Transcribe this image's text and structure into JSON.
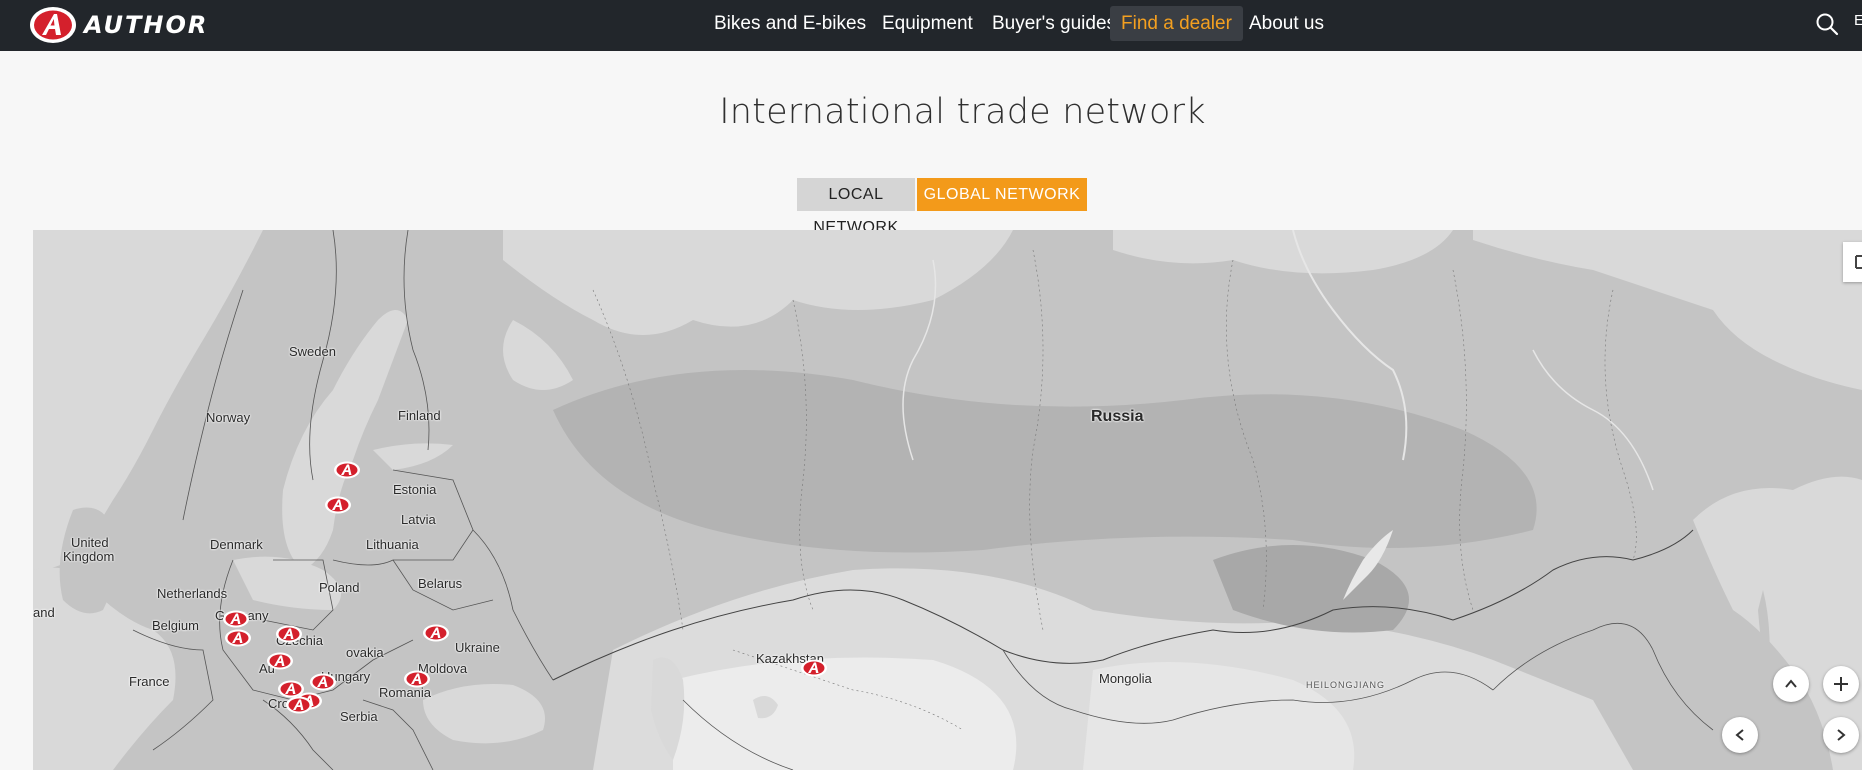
{
  "brand": {
    "name": "AUTHOR",
    "accent": "#f39a1a",
    "logo_red": "#d4202c"
  },
  "nav": {
    "items": [
      {
        "label": "Bikes and E-bikes"
      },
      {
        "label": "Equipment"
      },
      {
        "label": "Buyer's guides"
      },
      {
        "label": "Find a dealer",
        "active": true
      },
      {
        "label": "About us"
      }
    ],
    "search_icon": "search-icon",
    "language_label": "E"
  },
  "page": {
    "title": "International trade network",
    "toggle": {
      "local_label": "LOCAL NETWORK",
      "global_label": "GLOBAL NETWORK",
      "selected": "global"
    }
  },
  "map": {
    "labels": {
      "sweden": "Sweden",
      "norway": "Norway",
      "finland": "Finland",
      "estonia": "Estonia",
      "latvia": "Latvia",
      "lithuania": "Lithuania",
      "denmark": "Denmark",
      "united_kingdom_1": "United",
      "united_kingdom_2": "Kingdom",
      "ireland": "and",
      "netherlands": "Netherlands",
      "belgium": "Belgium",
      "germany": "Germany",
      "poland": "Poland",
      "belarus": "Belarus",
      "czechia": "Czechia",
      "slovakia": "ovakia",
      "austria": "Au",
      "hungary": "Hungary",
      "france": "France",
      "croatia": "Croatia",
      "serbia": "Serbia",
      "romania": "Romania",
      "moldova": "Moldova",
      "ukraine": "Ukraine",
      "russia": "Russia",
      "kazakhstan": "Kazakhstan",
      "mongolia": "Mongolia",
      "heilongjiang": "HEILONGJIANG"
    },
    "dealer_marker_count": 13,
    "controls": {
      "fullscreen_icon": "fullscreen-icon",
      "zoom_in_icon": "plus-icon",
      "pan_up_icon": "chevron-up-icon",
      "pan_left_icon": "chevron-left-icon",
      "pan_right_icon": "chevron-right-icon"
    }
  }
}
